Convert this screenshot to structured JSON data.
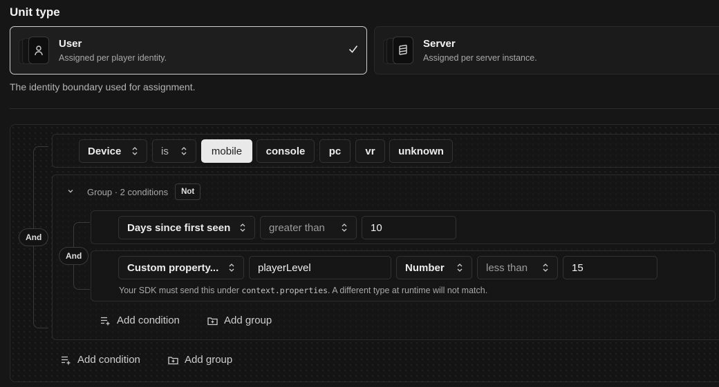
{
  "unit_type": {
    "title": "Unit type",
    "options": [
      {
        "label": "User",
        "description": "Assigned per player identity.",
        "selected": true
      },
      {
        "label": "Server",
        "description": "Assigned per server instance.",
        "selected": false
      }
    ],
    "hint": "The identity boundary used for assignment."
  },
  "builder": {
    "root_operator": "And",
    "device_row": {
      "field": "Device",
      "operator": "is",
      "values": [
        "mobile",
        "console",
        "pc",
        "vr",
        "unknown"
      ],
      "active_value": "mobile"
    },
    "group": {
      "label": "Group · 2 conditions",
      "not_label": "Not",
      "operator": "And",
      "conditions": [
        {
          "field": "Days since first seen",
          "operator": "greater than",
          "value": "10"
        },
        {
          "field": "Custom property...",
          "property_key": "playerLevel",
          "type": "Number",
          "operator": "less than",
          "value": "15",
          "note_prefix": "Your SDK must send this under ",
          "note_code": "context.properties",
          "note_suffix": ". A different type at runtime will not match."
        }
      ],
      "add_condition": "Add condition",
      "add_group": "Add group"
    },
    "add_condition": "Add condition",
    "add_group": "Add group"
  },
  "colors": {
    "background": "#161616",
    "selected_border": "#cfcfcf",
    "active_chip": "#e9e9e9"
  },
  "icons": {
    "user": "user-icon",
    "server": "server-icon",
    "check": "check-icon",
    "updown": "chevron-up-down-icon",
    "collapse": "chevron-down-icon",
    "add_condition": "list-plus-icon",
    "add_group": "folder-plus-icon"
  }
}
